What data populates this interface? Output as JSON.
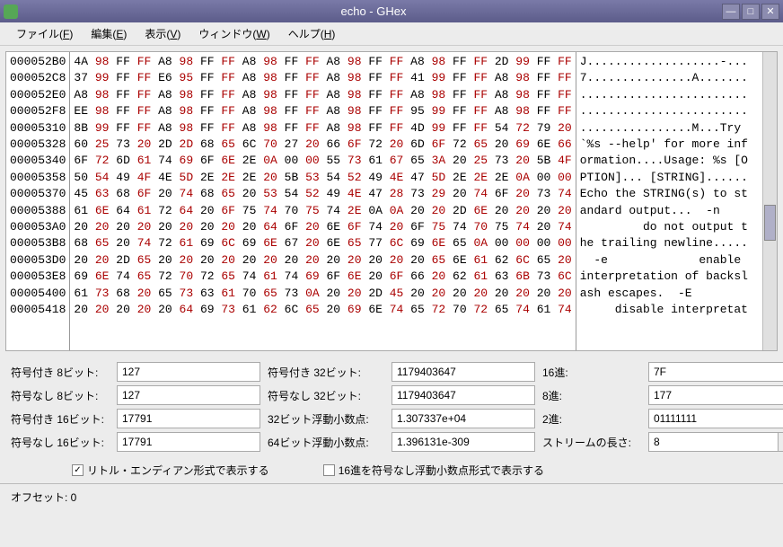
{
  "window": {
    "title": "echo - GHex"
  },
  "menu": {
    "file": "ファイル(F)",
    "edit": "編集(E)",
    "view": "表示(V)",
    "window": "ウィンドウ(W)",
    "help": "ヘルプ(H)"
  },
  "hex": {
    "offsets": [
      "000052B0",
      "000052C8",
      "000052E0",
      "000052F8",
      "00005310",
      "00005328",
      "00005340",
      "00005358",
      "00005370",
      "00005388",
      "000053A0",
      "000053B8",
      "000053D0",
      "000053E8",
      "00005400",
      "00005418"
    ],
    "bytes": [
      "4A 98 FF FF A8 98 FF FF A8 98 FF FF A8 98 FF FF A8 98 FF FF 2D 99 FF FF",
      "37 99 FF FF E6 95 FF FF A8 98 FF FF A8 98 FF FF 41 99 FF FF A8 98 FF FF",
      "A8 98 FF FF A8 98 FF FF A8 98 FF FF A8 98 FF FF A8 98 FF FF A8 98 FF FF",
      "EE 98 FF FF A8 98 FF FF A8 98 FF FF A8 98 FF FF 95 99 FF FF A8 98 FF FF",
      "8B 99 FF FF A8 98 FF FF A8 98 FF FF A8 98 FF FF 4D 99 FF FF 54 72 79 20",
      "60 25 73 20 2D 2D 68 65 6C 70 27 20 66 6F 72 20 6D 6F 72 65 20 69 6E 66",
      "6F 72 6D 61 74 69 6F 6E 2E 0A 00 00 55 73 61 67 65 3A 20 25 73 20 5B 4F",
      "50 54 49 4F 4E 5D 2E 2E 2E 20 5B 53 54 52 49 4E 47 5D 2E 2E 2E 0A 00 00",
      "45 63 68 6F 20 74 68 65 20 53 54 52 49 4E 47 28 73 29 20 74 6F 20 73 74",
      "61 6E 64 61 72 64 20 6F 75 74 70 75 74 2E 0A 0A 20 20 2D 6E 20 20 20 20",
      "20 20 20 20 20 20 20 20 20 64 6F 20 6E 6F 74 20 6F 75 74 70 75 74 20 74",
      "68 65 20 74 72 61 69 6C 69 6E 67 20 6E 65 77 6C 69 6E 65 0A 00 00 00 00",
      "20 20 2D 65 20 20 20 20 20 20 20 20 20 20 20 20 20 65 6E 61 62 6C 65 20",
      "69 6E 74 65 72 70 72 65 74 61 74 69 6F 6E 20 6F 66 20 62 61 63 6B 73 6C",
      "61 73 68 20 65 73 63 61 70 65 73 0A 20 20 2D 45 20 20 20 20 20 20 20 20",
      "20 20 20 20 20 64 69 73 61 62 6C 65 20 69 6E 74 65 72 70 72 65 74 61 74"
    ],
    "ascii": [
      "J...................-...",
      "7...............A.......",
      "........................",
      "........................",
      "................M...Try ",
      "`%s --help' for more inf",
      "ormation....Usage: %s [O",
      "PTION]... [STRING]......",
      "Echo the STRING(s) to st",
      "andard output...  -n    ",
      "         do not output t",
      "he trailing newline.....",
      "  -e             enable ",
      "interpretation of backsl",
      "ash escapes.  -E        ",
      "     disable interpretat"
    ]
  },
  "labels": {
    "s8": "符号付き 8ビット:",
    "u8": "符号なし 8ビット:",
    "s16": "符号付き 16ビット:",
    "u16": "符号なし 16ビット:",
    "s32": "符号付き 32ビット:",
    "u32": "符号なし 32ビット:",
    "f32": "32ビット浮動小数点:",
    "f64": "64ビット浮動小数点:",
    "hex": "16進:",
    "oct": "8進:",
    "bin": "2進:",
    "len": "ストリームの長さ:"
  },
  "values": {
    "s8": "127",
    "u8": "127",
    "s16": "17791",
    "u16": "17791",
    "s32": "1179403647",
    "u32": "1179403647",
    "f32": "1.307337e+04",
    "f64": "1.396131e-309",
    "hex": "7F",
    "oct": "177",
    "bin": "01111111",
    "len": "8"
  },
  "checks": {
    "le": "リトル・エンディアン形式で表示する",
    "hexuf": "16進を符号なし浮動小数点形式で表示する"
  },
  "status": {
    "offset": "オフセット: 0"
  }
}
